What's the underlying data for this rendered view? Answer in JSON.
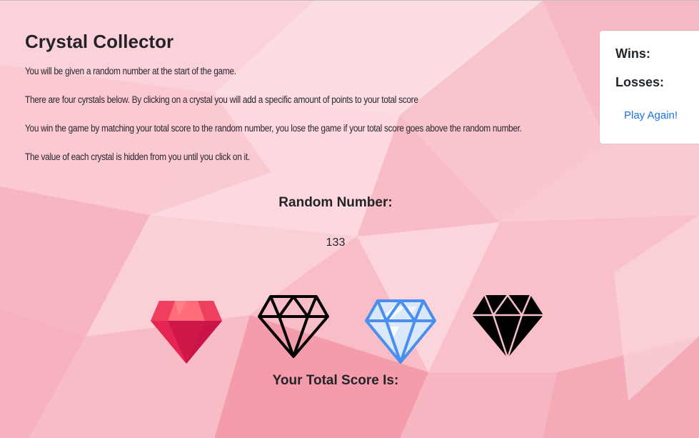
{
  "page": {
    "title": "Crystal Collector",
    "instructions": [
      "You will be given a random number at the start of the game.",
      "There are four cyrstals below. By clicking on a crystal you will add a specific amount of points to your total score",
      "You win the game by matching your total score to the random number, you lose the game if your total score goes above the random number.",
      "The value of each crystal is hidden from you until you click on it."
    ]
  },
  "scoreboard": {
    "wins_label": "Wins:",
    "wins_value": "",
    "losses_label": "Losses:",
    "losses_value": "",
    "play_again_label": "Play Again!"
  },
  "game": {
    "random_number_label": "Random Number:",
    "random_number": "133",
    "total_score_label": "Your Total Score Is:",
    "total_score": ""
  },
  "crystals": [
    {
      "icon": "red-ruby-crystal-icon",
      "color": "#e0244b"
    },
    {
      "icon": "outline-diamond-crystal-icon",
      "color": "#000000"
    },
    {
      "icon": "blue-diamond-crystal-icon",
      "color": "#4a8ff0"
    },
    {
      "icon": "black-diamond-crystal-icon",
      "color": "#000000"
    }
  ],
  "colors": {
    "background": "#f9c2cc",
    "link": "#1a73e8",
    "panel": "#ffffff"
  }
}
